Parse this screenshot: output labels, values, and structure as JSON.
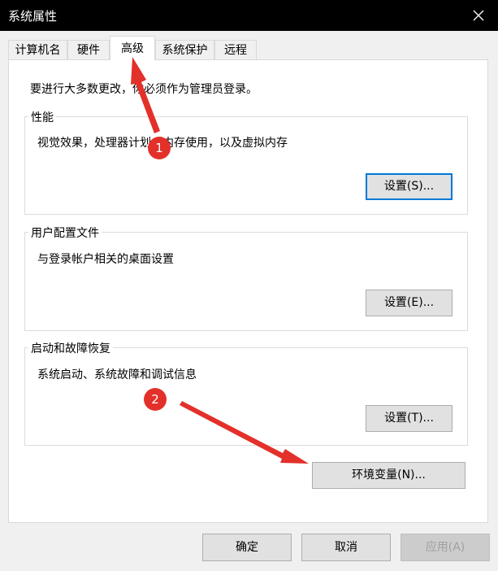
{
  "window": {
    "title": "系统属性"
  },
  "tabs": [
    {
      "label": "计算机名"
    },
    {
      "label": "硬件"
    },
    {
      "label": "高级"
    },
    {
      "label": "系统保护"
    },
    {
      "label": "远程"
    }
  ],
  "notice": "要进行大多数更改，你必须作为管理员登录。",
  "groups": {
    "performance": {
      "title": "性能",
      "description": "视觉效果，处理器计划，内存使用，以及虚拟内存",
      "button": "设置(S)..."
    },
    "profiles": {
      "title": "用户配置文件",
      "description": "与登录帐户相关的桌面设置",
      "button": "设置(E)..."
    },
    "startup": {
      "title": "启动和故障恢复",
      "description": "系统启动、系统故障和调试信息",
      "button": "设置(T)..."
    }
  },
  "env_button": "环境变量(N)...",
  "footer": {
    "ok": "确定",
    "cancel": "取消",
    "apply": "应用(A)"
  },
  "annotations": [
    {
      "label": "1"
    },
    {
      "label": "2"
    }
  ],
  "colors": {
    "accent": "#0078d7",
    "marker": "#e3302a"
  }
}
